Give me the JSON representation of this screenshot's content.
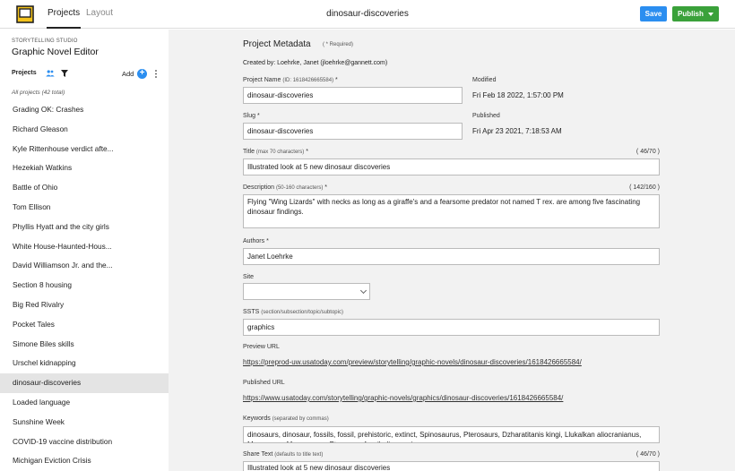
{
  "header": {
    "tabs": [
      {
        "label": "Projects",
        "active": true
      },
      {
        "label": "Layout",
        "active": false
      }
    ],
    "title": "dinosaur-discoveries",
    "save_label": "Save",
    "publish_label": "Publish"
  },
  "sidebar": {
    "studio": "STORYTELLING STUDIO",
    "title": "Graphic Novel Editor",
    "projects_label": "Projects",
    "add_label": "Add",
    "count_label": "All projects (42 total)",
    "items": [
      "Grading OK: Crashes",
      "Richard Gleason",
      "Kyle Rittenhouse verdict afte...",
      "Hezekiah Watkins",
      "Battle of Ohio",
      "Tom Ellison",
      "Phyllis Hyatt and the city girls",
      "White House-Haunted-Hous...",
      "David Williamson Jr. and the...",
      "Section 8 housing",
      "Big Red Rivalry",
      "Pocket Tales",
      "Simone Biles skills",
      "Urschel kidnapping",
      "dinosaur-discoveries",
      "Loaded language",
      "Sunshine Week",
      "COVID-19 vaccine distribution",
      "Michigan Eviction Crisis"
    ],
    "active_item": "dinosaur-discoveries"
  },
  "main": {
    "section_title": "Project Metadata",
    "required_note": "( * Required)",
    "created_by": "Created by: Loehrke, Janet (jloehrke@gannett.com)",
    "project_name": {
      "label": "Project Name",
      "sub": "(ID: 1618426665584)",
      "star": "*",
      "value": "dinosaur-discoveries"
    },
    "modified": {
      "label": "Modified",
      "value": "Fri Feb 18 2022, 1:57:00 PM"
    },
    "slug": {
      "label": "Slug",
      "star": "*",
      "value": "dinosaur-discoveries"
    },
    "published": {
      "label": "Published",
      "value": "Fri Apr 23 2021, 7:18:53 AM"
    },
    "title_field": {
      "label": "Title",
      "sub": "(max 70 characters)",
      "star": "*",
      "counter": "( 46/70 )",
      "value": "Illustrated look at 5 new dinosaur discoveries"
    },
    "description": {
      "label": "Description",
      "sub": "(50-160 characters)",
      "star": "*",
      "counter": "( 142/160 )",
      "value": "Flying \"Wing Lizards\" with necks as long as a giraffe's and a fearsome predator not named T rex. are among five fascinating dinosaur findings."
    },
    "authors": {
      "label": "Authors",
      "star": "*",
      "value": "Janet Loehrke"
    },
    "site": {
      "label": "Site",
      "value": ""
    },
    "ssts": {
      "label": "SSTS",
      "sub": "(section/subsection/topic/subtopic)",
      "value": "graphics"
    },
    "preview_url": {
      "label": "Preview URL",
      "value": "https://preprod-uw.usatoday.com/preview/storytelling/graphic-novels/dinosaur-discoveries/1618426665584/"
    },
    "published_url": {
      "label": "Published URL",
      "value": "https://www.usatoday.com/storytelling/graphic-novels/graphics/dinosaur-discoveries/1618426665584/"
    },
    "keywords": {
      "label": "Keywords",
      "sub": "(separated by commas)",
      "value": "dinosaurs, dinosaur, fossils, fossil, prehistoric, extinct, Spinosaurus, Pterosaurs, Dzharatitanis kingi, Llukalkan aliocranianus, Mosasaurs, Mosasaurus, Pterosaur, fossil, discoveries"
    },
    "share_text": {
      "label": "Share Text",
      "sub": "(defaults to title text)",
      "counter": "( 46/70 )",
      "value": "Illustrated look at 5 new dinosaur discoveries"
    }
  }
}
